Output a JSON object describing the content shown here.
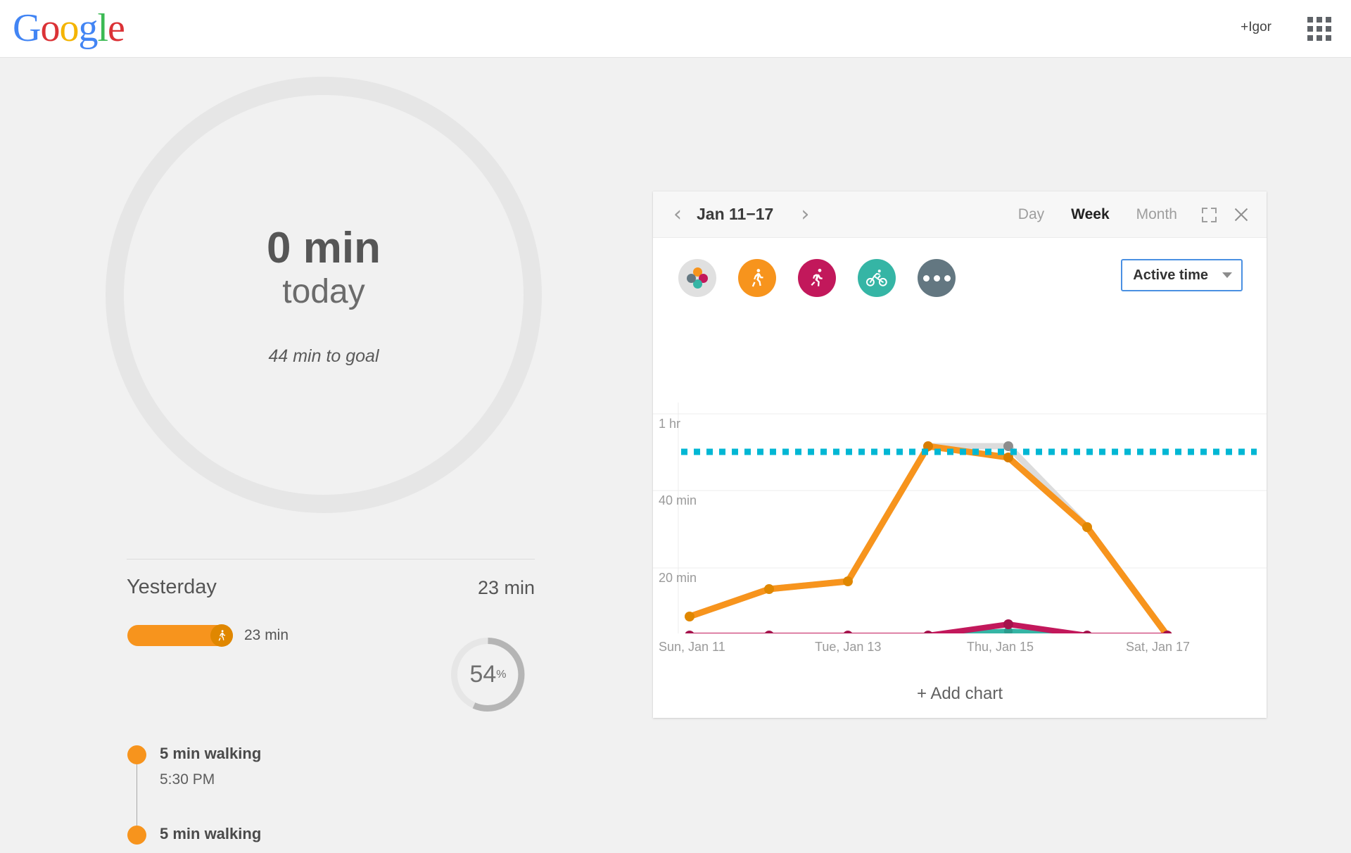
{
  "topbar": {
    "logo_letters": [
      {
        "ch": "G",
        "color": "#4285f4"
      },
      {
        "ch": "o",
        "color": "#db3236"
      },
      {
        "ch": "o",
        "color": "#f4b400"
      },
      {
        "ch": "g",
        "color": "#4285f4"
      },
      {
        "ch": "l",
        "color": "#3cba54"
      },
      {
        "ch": "e",
        "color": "#db3236"
      }
    ],
    "logo_text": "Google",
    "account_label": "+Igor",
    "apps_icon": "apps-grid-icon"
  },
  "today": {
    "value": "0 min",
    "label": "today",
    "goal_note": "44 min to goal",
    "ring_color": "#e6e6e6"
  },
  "yesterday": {
    "title": "Yesterday",
    "total": "23 min",
    "bar": {
      "value_label": "23 min",
      "color": "#f7941d",
      "knob_icon": "walking-icon",
      "fill_pct": 54
    },
    "donut": {
      "value": "54",
      "unit": "%",
      "percent": 54,
      "track_color": "#e6e6e6",
      "arc_color": "#b5b5b5"
    }
  },
  "activities": [
    {
      "title": "5 min walking",
      "time": "5:30 PM",
      "dot_color": "#f7941d"
    },
    {
      "title": "5 min walking",
      "time": "",
      "dot_color": "#f7941d"
    }
  ],
  "card": {
    "header": {
      "prev_icon": "chevron-left-icon",
      "next_icon": "chevron-right-icon",
      "range": "Jan 11−17",
      "segments": [
        {
          "label": "Day",
          "active": false
        },
        {
          "label": "Week",
          "active": true
        },
        {
          "label": "Month",
          "active": false
        }
      ],
      "expand_icon": "expand-icon",
      "close_icon": "close-icon"
    },
    "filters": [
      {
        "name": "all-activities",
        "color": "#e0e0e0",
        "icon": "multi-dots-icon"
      },
      {
        "name": "walking",
        "color": "#f7941d",
        "icon": "walking-icon"
      },
      {
        "name": "running",
        "color": "#c2185b",
        "icon": "running-icon"
      },
      {
        "name": "cycling",
        "color": "#35b5a5",
        "icon": "cycling-icon"
      },
      {
        "name": "more",
        "color": "#637781",
        "icon": "more-icon"
      }
    ],
    "metric_dropdown": {
      "label": "Active time",
      "border_color": "#4a90e2",
      "caret_icon": "chevron-down-icon"
    },
    "add_chart": "+ Add chart"
  },
  "chart_data": {
    "type": "line",
    "title": "Active time",
    "xlabel": "",
    "ylabel": "",
    "grid": true,
    "legend": "none",
    "ylim": [
      0,
      65
    ],
    "ytick_values": [
      20,
      40,
      60
    ],
    "ytick_labels": [
      "20 min",
      "40 min",
      "1 hr"
    ],
    "x": [
      "Sun, Jan 11",
      "Mon, Jan 12",
      "Tue, Jan 13",
      "Wed, Jan 14",
      "Thu, Jan 15",
      "Fri, Jan 16",
      "Sat, Jan 17"
    ],
    "xtick_labels": [
      "Sun, Jan 11",
      "",
      "Tue, Jan 13",
      "",
      "Thu, Jan 15",
      "",
      "Sat, Jan 17"
    ],
    "series": [
      {
        "name": "Total (all activities)",
        "color": "#dcdcdc",
        "values": [
          5,
          12,
          14,
          49,
          49,
          28,
          0
        ]
      },
      {
        "name": "Walking",
        "color": "#f7941d",
        "values": [
          5,
          12,
          14,
          49,
          46,
          28,
          0
        ]
      },
      {
        "name": "Running",
        "color": "#c2185b",
        "values": [
          0,
          0,
          0,
          0,
          3,
          0,
          0
        ]
      },
      {
        "name": "Cycling",
        "color": "#35b5a5",
        "values": [
          0,
          0,
          0,
          0,
          1,
          0,
          0
        ]
      }
    ],
    "goal_line": {
      "value": 50,
      "color": "#00b7d4",
      "style": "dotted",
      "label": ""
    }
  }
}
